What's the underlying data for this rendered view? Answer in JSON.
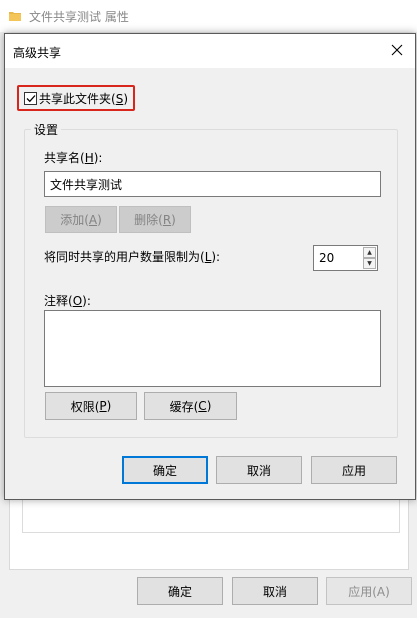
{
  "background_window": {
    "title": "文件共享测试 属性",
    "buttons": {
      "ok": "确定",
      "cancel": "取消",
      "apply": "应用(A)"
    }
  },
  "dialog": {
    "title": "高级共享",
    "share_checkbox": {
      "label_prefix": "共享此文件夹(",
      "mnemonic": "S",
      "label_suffix": ")",
      "checked": true
    },
    "group_title": "设置",
    "share_name": {
      "label_prefix": "共享名(",
      "mnemonic": "H",
      "label_suffix": "):",
      "value": "文件共享测试"
    },
    "add_button": {
      "prefix": "添加(",
      "mnemonic": "A",
      "suffix": ")"
    },
    "remove_button": {
      "prefix": "删除(",
      "mnemonic": "R",
      "suffix": ")"
    },
    "user_limit": {
      "label_prefix": "将同时共享的用户数量限制为(",
      "mnemonic": "L",
      "label_suffix": "):",
      "value": "20"
    },
    "comment": {
      "label_prefix": "注释(",
      "mnemonic": "O",
      "label_suffix": "):",
      "value": ""
    },
    "permissions_button": {
      "prefix": "权限(",
      "mnemonic": "P",
      "suffix": ")"
    },
    "caching_button": {
      "prefix": "缓存(",
      "mnemonic": "C",
      "suffix": ")"
    },
    "footer_buttons": {
      "ok": "确定",
      "cancel": "取消",
      "apply": "应用"
    }
  },
  "colors": {
    "highlight_border": "#d9261c",
    "default_button_border": "#0078d7",
    "dialog_bg": "#f0f0f0",
    "folder_icon": "#e8b84a"
  },
  "icons": [
    "folder-icon",
    "close-icon",
    "checkmark-icon",
    "spin-up-icon",
    "spin-down-icon"
  ]
}
